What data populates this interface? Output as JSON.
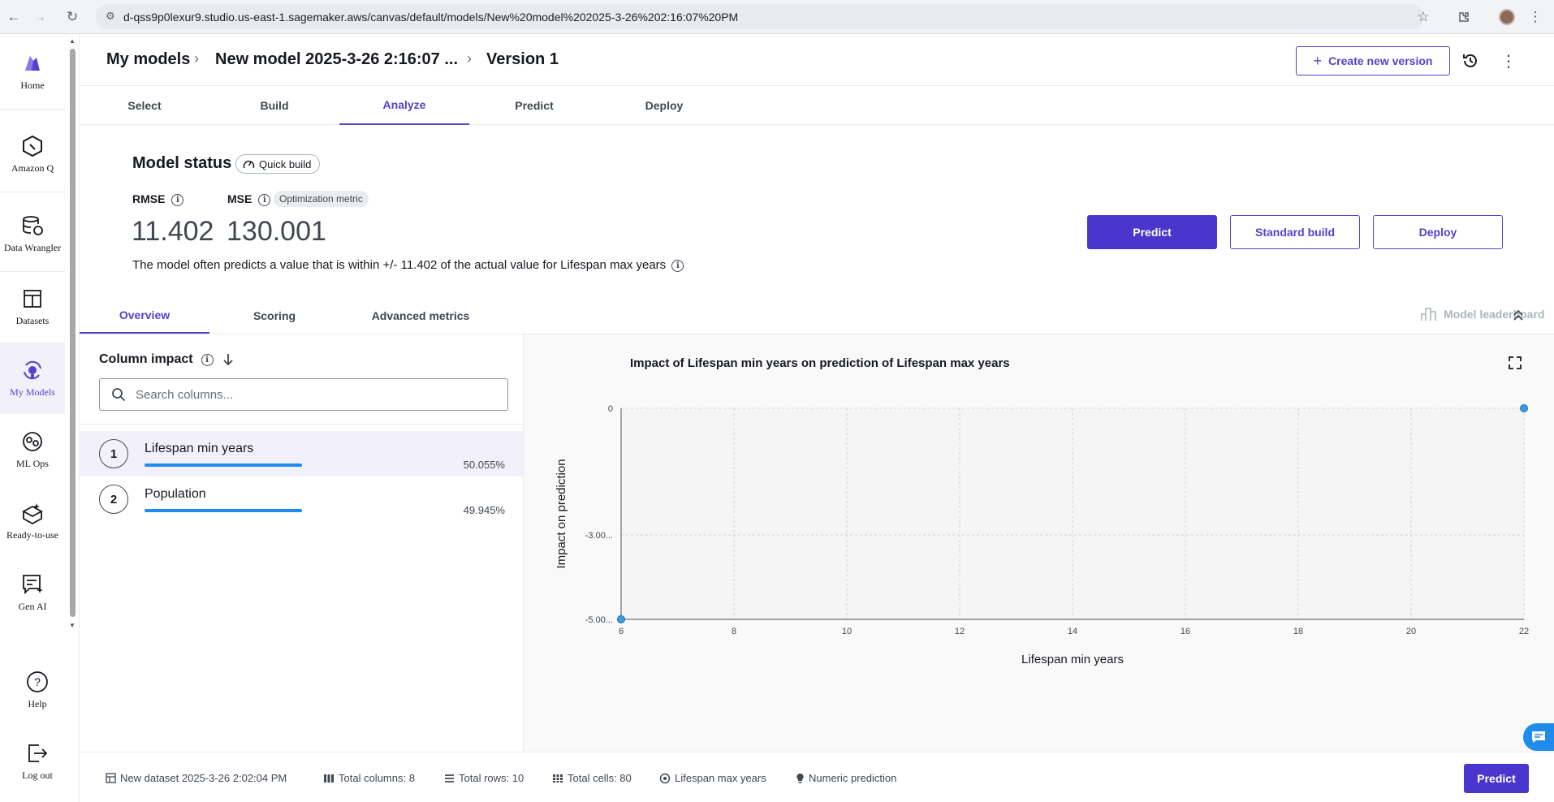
{
  "browser": {
    "url": "d-qss9p0lexur9.studio.us-east-1.sagemaker.aws/canvas/default/models/New%20model%202025-3-26%202:16:07%20PM"
  },
  "nav": {
    "items": [
      {
        "label": "Home",
        "icon": "home-logo-icon"
      },
      {
        "label": "Amazon Q",
        "icon": "amazon-q-icon"
      },
      {
        "label": "Data Wrangler",
        "icon": "data-wrangler-icon"
      },
      {
        "label": "Datasets",
        "icon": "datasets-icon"
      },
      {
        "label": "My Models",
        "icon": "my-models-icon"
      },
      {
        "label": "ML Ops",
        "icon": "ml-ops-icon"
      },
      {
        "label": "Ready-to-use",
        "icon": "ready-to-use-icon"
      },
      {
        "label": "Gen AI",
        "icon": "gen-ai-icon"
      },
      {
        "label": "Help",
        "icon": "help-icon"
      },
      {
        "label": "Log out",
        "icon": "logout-icon"
      }
    ],
    "active": "My Models"
  },
  "header": {
    "breadcrumb_root": "My models",
    "breadcrumb_model": "New model 2025-3-26 2:16:07 ...",
    "breadcrumb_version": "Version 1",
    "create_label": "Create new version"
  },
  "tabs": {
    "main": [
      "Select",
      "Build",
      "Analyze",
      "Predict",
      "Deploy"
    ],
    "active": "Analyze"
  },
  "status": {
    "title": "Model status",
    "build_badge": "Quick build",
    "rmse_label": "RMSE",
    "rmse_value": "11.402",
    "mse_label": "MSE",
    "mse_value": "130.001",
    "optimization_badge": "Optimization metric",
    "explanation": "The model often predicts a value that is within +/- 11.402 of the actual value for Lifespan max years",
    "predict_label": "Predict",
    "standard_build_label": "Standard build",
    "deploy_label": "Deploy"
  },
  "subtabs": {
    "items": [
      "Overview",
      "Scoring",
      "Advanced metrics"
    ],
    "active": "Overview",
    "leaderboard_label": "Model leaderboard"
  },
  "column_impact": {
    "title": "Column impact",
    "search_placeholder": "Search columns...",
    "rows": [
      {
        "rank": "1",
        "name": "Lifespan min years",
        "percent": "50.055%",
        "share": 0.50055
      },
      {
        "rank": "2",
        "name": "Population",
        "percent": "49.945%",
        "share": 0.49945
      }
    ]
  },
  "chart_data": {
    "type": "scatter",
    "title": "Impact of Lifespan min years on prediction of Lifespan max years",
    "xlabel": "Lifespan min years",
    "ylabel": "Impact on prediction",
    "x_ticks": [
      "6",
      "8",
      "10",
      "12",
      "14",
      "16",
      "18",
      "20",
      "22"
    ],
    "y_ticks": [
      "0",
      "-3.00...",
      "-5.00..."
    ],
    "xlim": [
      6,
      22
    ],
    "ylim": [
      -5,
      0
    ],
    "grid": true,
    "points": [
      {
        "x": 6,
        "y": -5
      },
      {
        "x": 22,
        "y": 0
      }
    ],
    "colors": {
      "point": "#3b9de0",
      "grid": "#cfd3d6"
    }
  },
  "footer": {
    "dataset": "New dataset 2025-3-26 2:02:04 PM",
    "columns": "Total columns: 8",
    "rows": "Total rows: 10",
    "cells": "Total cells: 80",
    "target": "Lifespan max years",
    "problem_type": "Numeric prediction",
    "predict_label": "Predict"
  }
}
